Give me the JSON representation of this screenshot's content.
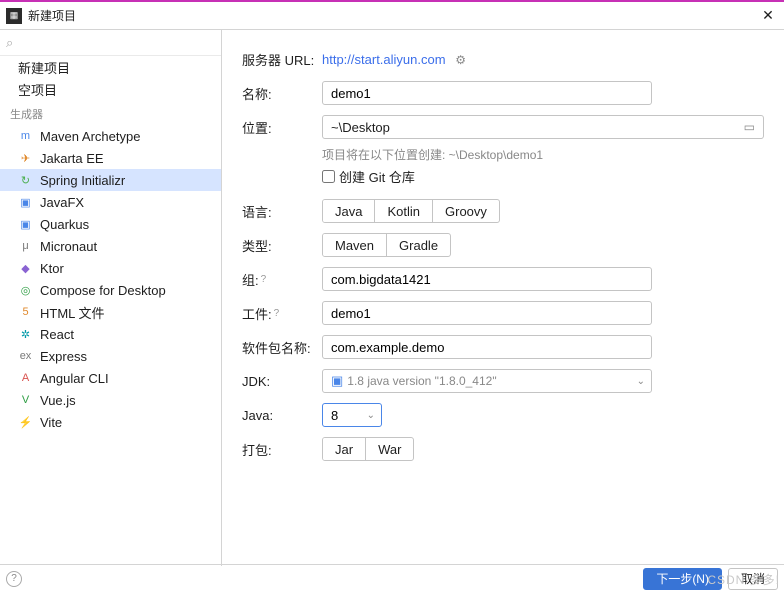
{
  "titlebar": {
    "title": "新建项目",
    "close": "✕"
  },
  "search": {
    "placeholder": "",
    "icon": "🔍"
  },
  "sidebar": {
    "top": [
      {
        "label": "新建项目"
      },
      {
        "label": "空项目"
      }
    ],
    "gen_header": "生成器",
    "generators": [
      {
        "icon": "m",
        "color": "c-blue",
        "label": "Maven Archetype"
      },
      {
        "icon": "✈",
        "color": "c-orange",
        "label": "Jakarta EE"
      },
      {
        "icon": "↻",
        "color": "c-green",
        "label": "Spring Initializr",
        "selected": true
      },
      {
        "icon": "▣",
        "color": "c-blue",
        "label": "JavaFX"
      },
      {
        "icon": "▣",
        "color": "c-blue",
        "label": "Quarkus"
      },
      {
        "icon": "μ",
        "color": "c-grey",
        "label": "Micronaut"
      },
      {
        "icon": "◆",
        "color": "c-purple",
        "label": "Ktor"
      },
      {
        "icon": "◎",
        "color": "c-dgreen",
        "label": "Compose for Desktop"
      },
      {
        "icon": "5",
        "color": "c-orange",
        "label": "HTML 文件"
      },
      {
        "icon": "✲",
        "color": "c-teal",
        "label": "React"
      },
      {
        "icon": "ex",
        "color": "c-grey",
        "label": "Express"
      },
      {
        "icon": "A",
        "color": "c-red",
        "label": "Angular CLI"
      },
      {
        "icon": "V",
        "color": "c-dgreen",
        "label": "Vue.js"
      },
      {
        "icon": "⚡",
        "color": "c-orange",
        "label": "Vite"
      }
    ]
  },
  "form": {
    "server_label": "服务器 URL:",
    "server_url": "http://start.aliyun.com",
    "name_label": "名称:",
    "name_value": "demo1",
    "loc_label": "位置:",
    "loc_value": "~\\Desktop",
    "loc_hint": "项目将在以下位置创建: ~\\Desktop\\demo1",
    "git_label": "创建 Git 仓库",
    "lang_label": "语言:",
    "lang_opts": [
      "Java",
      "Kotlin",
      "Groovy"
    ],
    "type_label": "类型:",
    "type_opts": [
      "Maven",
      "Gradle"
    ],
    "group_label": "组:",
    "group_value": "com.bigdata1421",
    "artifact_label": "工件:",
    "artifact_value": "demo1",
    "package_label": "软件包名称:",
    "package_value": "com.example.demo",
    "jdk_label": "JDK:",
    "jdk_value": "1.8 java version \"1.8.0_412\"",
    "java_label": "Java:",
    "java_value": "8",
    "pack_label": "打包:",
    "pack_opts": [
      "Jar",
      "War"
    ]
  },
  "footer": {
    "next": "下一步(N)",
    "cancel": "取消",
    "watermark": "CSDN 多多!"
  }
}
